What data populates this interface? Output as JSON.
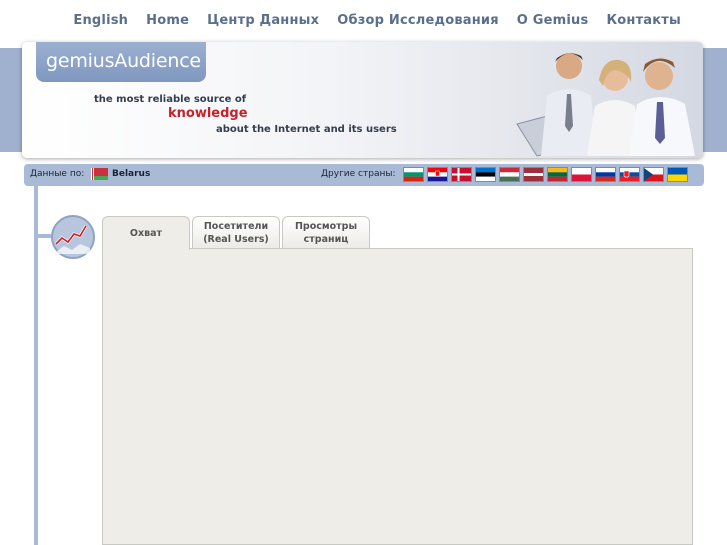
{
  "nav": {
    "items": [
      "English",
      "Home",
      "Центр Данных",
      "Обзор Исследования",
      "О Gemius",
      "Контакты"
    ]
  },
  "banner": {
    "logo": "gemiusAudience",
    "tagline_1": "the most reliable source of",
    "tagline_2": "knowledge",
    "tagline_3": "about the Internet and its users"
  },
  "countrybar": {
    "data_label": "Данные по:",
    "current_country": "Belarus",
    "other_label": "Другие страны:",
    "flag_icons": [
      "bulgaria-flag-icon",
      "croatia-flag-icon",
      "denmark-flag-icon",
      "estonia-flag-icon",
      "hungary-flag-icon",
      "latvia-flag-icon",
      "lithuania-flag-icon",
      "poland-flag-icon",
      "russia-flag-icon",
      "slovakia-flag-icon",
      "czech-flag-icon",
      "ukraine-flag-icon"
    ]
  },
  "tabs": [
    {
      "label": "Охват",
      "active": true
    },
    {
      "label": "Посетители\n(Real Users)",
      "active": false
    },
    {
      "label": "Просмотры\nстраниц",
      "active": false
    }
  ],
  "colors": {
    "nav_text": "#5b6f8c",
    "band": "#9fb1cf",
    "country_bar": "#a9bad6",
    "content_bg": "#efede7",
    "accent_red": "#c4232b"
  }
}
